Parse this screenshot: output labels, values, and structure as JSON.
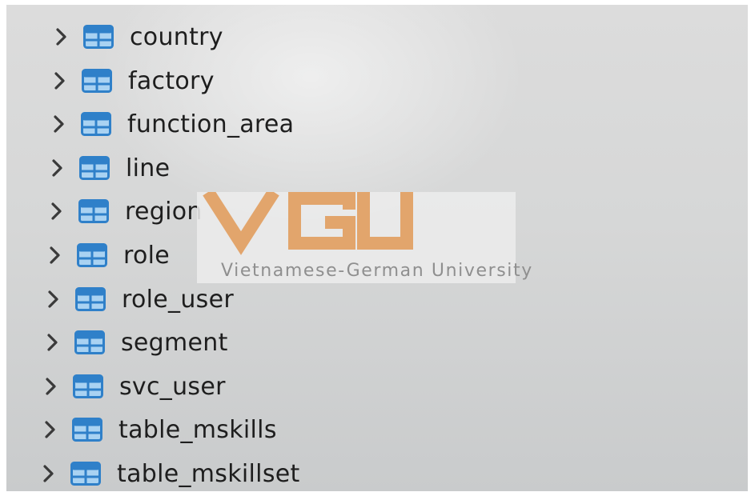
{
  "tree": {
    "items": [
      {
        "label": "country",
        "expand_icon": "chevron-right-icon",
        "icon": "table-icon"
      },
      {
        "label": "factory",
        "expand_icon": "chevron-right-icon",
        "icon": "table-icon"
      },
      {
        "label": "function_area",
        "expand_icon": "chevron-right-icon",
        "icon": "table-icon"
      },
      {
        "label": "line",
        "expand_icon": "chevron-right-icon",
        "icon": "table-icon"
      },
      {
        "label": "region",
        "expand_icon": "chevron-right-icon",
        "icon": "table-icon"
      },
      {
        "label": "role",
        "expand_icon": "chevron-right-icon",
        "icon": "table-icon"
      },
      {
        "label": "role_user",
        "expand_icon": "chevron-right-icon",
        "icon": "table-icon"
      },
      {
        "label": "segment",
        "expand_icon": "chevron-right-icon",
        "icon": "table-icon"
      },
      {
        "label": "svc_user",
        "expand_icon": "chevron-right-icon",
        "icon": "table-icon"
      },
      {
        "label": "table_mskills",
        "expand_icon": "chevron-right-icon",
        "icon": "table-icon"
      },
      {
        "label": "table_mskillset",
        "expand_icon": "chevron-right-icon",
        "icon": "table-icon"
      }
    ]
  },
  "watermark": {
    "logo_text": "VGU",
    "text": "Vietnamese-German University"
  },
  "colors": {
    "table_icon_blue": "#2f80c9",
    "table_icon_light": "#a9d2f2",
    "watermark_orange": "#e2a56c",
    "watermark_text": "#8f8f8f"
  }
}
